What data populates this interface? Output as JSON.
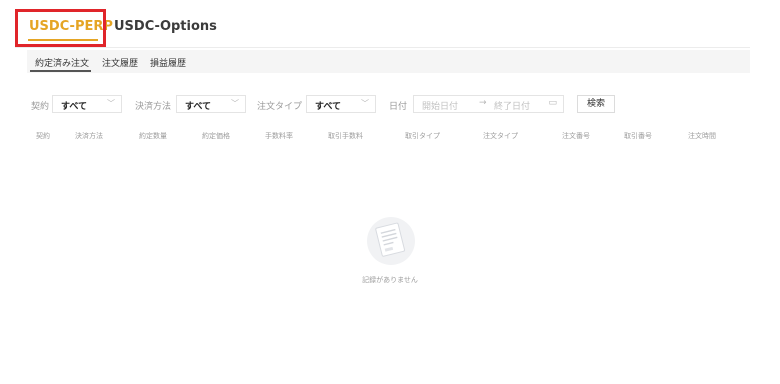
{
  "tabs": {
    "perp": "USDC-PERP",
    "options": "USDC-Options"
  },
  "subtabs": [
    "約定済み注文",
    "注文履歴",
    "損益履歴"
  ],
  "filters": {
    "contract_label": "契約",
    "contract_value": "すべて",
    "settlement_label": "決済方法",
    "settlement_value": "すべて",
    "order_type_label": "注文タイプ",
    "order_type_value": "すべて",
    "date_label": "日付",
    "start_placeholder": "開始日付",
    "end_placeholder": "終了日付",
    "search_label": "検索"
  },
  "columns": [
    "契約",
    "決済方法",
    "約定数量",
    "約定価格",
    "手数料率",
    "取引手数料",
    "取引タイプ",
    "注文タイプ",
    "注文番号",
    "取引番号",
    "注文時間"
  ],
  "empty_text": "記録がありません",
  "colors": {
    "accent": "#e5a524",
    "highlight": "#e0252a"
  }
}
